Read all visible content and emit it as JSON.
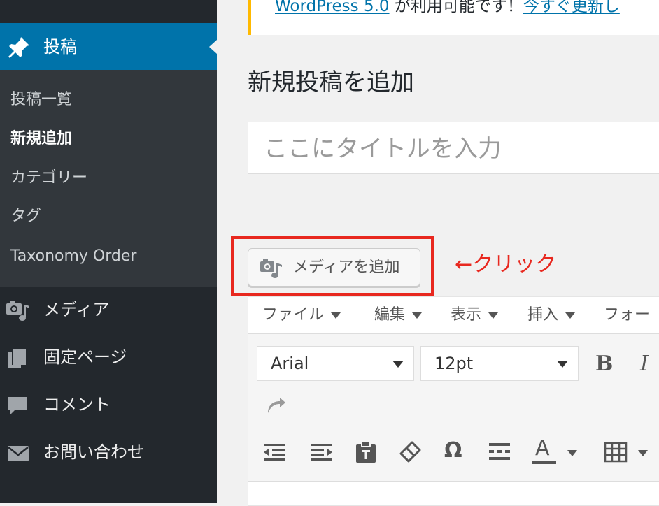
{
  "notice": {
    "version_link": "WordPress 5.0",
    "message": " が利用可能です！",
    "update_link": "今すぐ更新し"
  },
  "sidebar": {
    "active_menu": {
      "label": "投稿",
      "icon": "pin-icon"
    },
    "submenu": [
      "投稿一覧",
      "新規追加",
      "カテゴリー",
      "タグ",
      "Taxonomy Order"
    ],
    "current_submenu": "新規追加",
    "menu_items": [
      {
        "label": "メディア",
        "icon": "media-icon"
      },
      {
        "label": "固定ページ",
        "icon": "pages-icon"
      },
      {
        "label": "コメント",
        "icon": "comments-icon"
      },
      {
        "label": "お問い合わせ",
        "icon": "mail-icon"
      }
    ]
  },
  "page": {
    "title": "新規投稿を追加",
    "title_placeholder": "ここにタイトルを入力"
  },
  "media_button": {
    "label": "メディアを追加",
    "icon": "add-media-icon"
  },
  "annotation": {
    "text": "←クリック"
  },
  "editor": {
    "menubar": [
      "ファイル",
      "編集",
      "表示",
      "挿入",
      "フォー"
    ],
    "font_family": "Arial",
    "font_size": "12pt",
    "toolbar_icons": [
      "bold-icon",
      "italic-icon",
      "redo-icon",
      "outdent-icon",
      "indent-icon",
      "paste-text-icon",
      "clear-formatting-icon",
      "special-character-icon",
      "page-break-icon",
      "text-color-icon",
      "table-icon"
    ],
    "bold_label": "B",
    "italic_label": "I",
    "omega_label": "Ω",
    "text_color_label": "A"
  },
  "colors": {
    "sidebar_bg": "#23282d",
    "submenu_bg": "#32373c",
    "active_blue": "#0073aa",
    "notice_accent": "#ffb900",
    "annotation_red": "#e8281f"
  }
}
